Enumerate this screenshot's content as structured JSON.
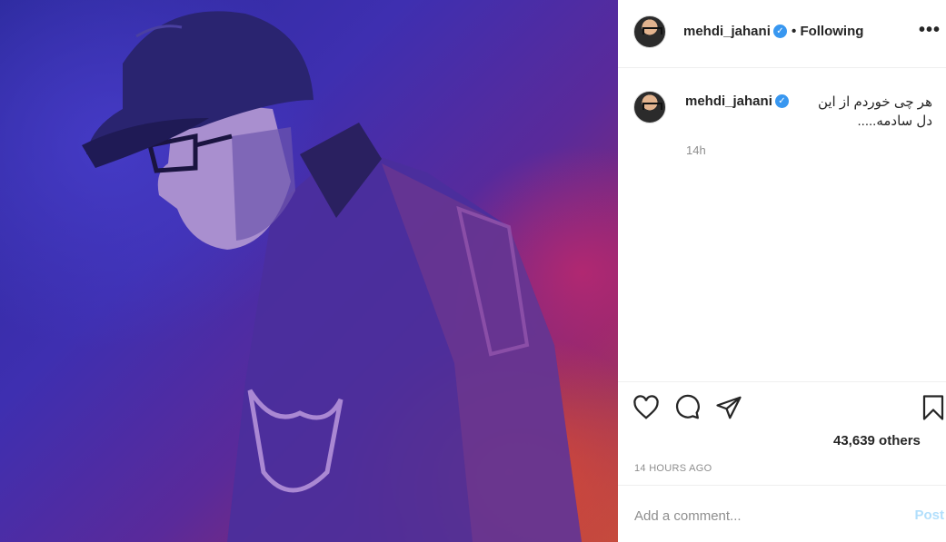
{
  "post": {
    "image_alt": "man in cap and jacket lit by purple and orange light",
    "author": {
      "username": "mehdi_jahani",
      "verified_icon": "verified-badge-icon",
      "follow_separator": "•",
      "follow_status": "Following"
    },
    "more_icon": "more-options-icon",
    "more_label": "•••",
    "caption": {
      "username": "mehdi_jahani",
      "text": "هر چی خوردم از این دل سادمه.....",
      "age": "14h"
    },
    "actions": {
      "like_icon": "heart-icon",
      "comment_icon": "comment-icon",
      "share_icon": "share-icon",
      "save_icon": "bookmark-icon"
    },
    "likes_text": "43,639 others",
    "timestamp": "14 HOURS AGO",
    "comment_box": {
      "placeholder": "Add a comment...",
      "post_label": "Post"
    }
  },
  "colors": {
    "accent": "#3897f0",
    "post_disabled": "#b2dffc",
    "secondary_text": "#8e8e8e",
    "divider": "#efefef"
  }
}
